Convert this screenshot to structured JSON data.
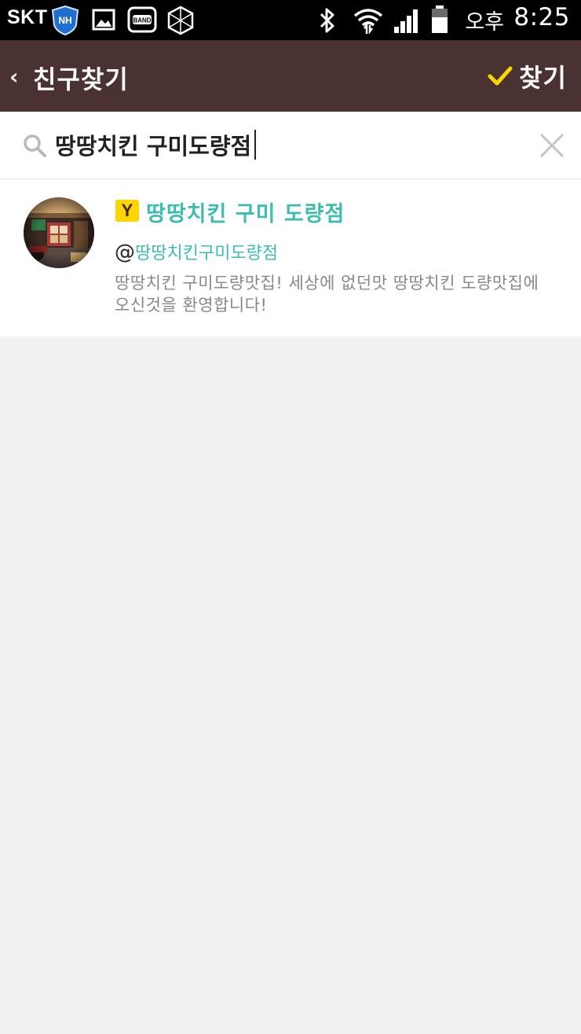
{
  "status_bar": {
    "carrier": "SKT",
    "nh_badge": "NH",
    "band_label": "BAND",
    "ampm": "오후",
    "time": "8:25",
    "icons": [
      "nh-shield-icon",
      "gallery-icon",
      "band-icon",
      "hexagon-app-icon",
      "bluetooth-icon",
      "wifi-icon",
      "signal-icon",
      "battery-icon"
    ]
  },
  "app_bar": {
    "title": "친구찾기",
    "find_label": "찾기",
    "background": "#4a3232",
    "check_color": "#f5d800"
  },
  "search": {
    "value": "땅땅치킨 구미도량점",
    "icon": "search-icon",
    "clear_icon": "close-icon"
  },
  "results": [
    {
      "badge": "Y",
      "name": "땅땅치킨 구미 도량점",
      "id_prefix": "@",
      "id": "땅땅치킨구미도량점",
      "description": "땅땅치킨 구미도량맛집! 세상에 없던맛 땅땅치킨 도량맛집에 오신것을 환영합니다!",
      "name_color": "#3fbcb0",
      "badge_color": "#ffd500"
    }
  ]
}
